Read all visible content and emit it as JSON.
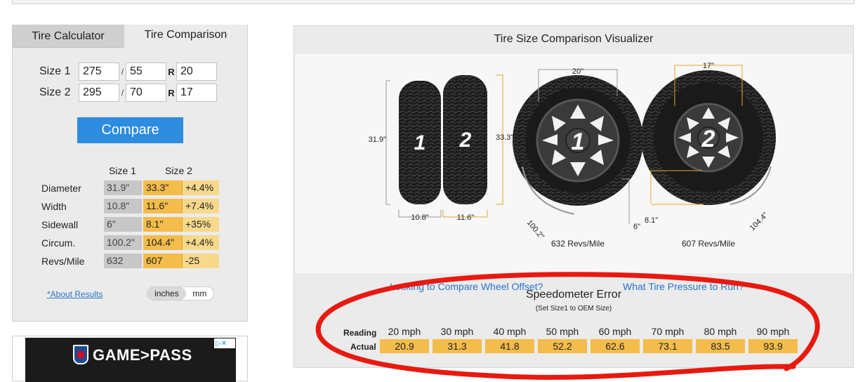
{
  "tabs": {
    "calculator": "Tire Calculator",
    "comparison": "Tire Comparison"
  },
  "inputs": {
    "size1": {
      "label": "Size 1",
      "width": "275",
      "aspect": "55",
      "rim": "20"
    },
    "size2": {
      "label": "Size 2",
      "width": "295",
      "aspect": "70",
      "rim": "17"
    },
    "slash": "/",
    "r": "R"
  },
  "compare_label": "Compare",
  "results": {
    "header_size1": "Size 1",
    "header_size2": "Size 2",
    "rows": [
      {
        "label": "Diameter",
        "s1": "31.9\"",
        "s2": "33.3\"",
        "diff": "+4.4%"
      },
      {
        "label": "Width",
        "s1": "10.8\"",
        "s2": "11.6\"",
        "diff": "+7.4%"
      },
      {
        "label": "Sidewall",
        "s1": "6\"",
        "s2": "8.1\"",
        "diff": "+35%"
      },
      {
        "label": "Circum.",
        "s1": "100.2\"",
        "s2": "104.4\"",
        "diff": "+4.4%"
      },
      {
        "label": "Revs/Mile",
        "s1": "632",
        "s2": "607",
        "diff": "-25"
      }
    ]
  },
  "about_link": "*About Results",
  "units": {
    "inches": "inches",
    "mm": "mm"
  },
  "ad": {
    "text": "GAME>PASS",
    "badge": "▷✕"
  },
  "visualizer": {
    "title": "Tire Size Comparison Visualizer",
    "tire1_number": "1",
    "tire2_number": "2",
    "dim_diameter1": "31.9\"",
    "dim_diameter2": "33.3\"",
    "dim_width1": "10.8\"",
    "dim_width2": "11.6\"",
    "rim1": "20\"",
    "rim2": "17\"",
    "sidewall1": "6\"",
    "sidewall2": "8.1\"",
    "circ1": "100.2\"",
    "circ2": "104.4\"",
    "revs1": "632 Revs/Mile",
    "revs2": "607 Revs/Mile",
    "link_offset": "Looking to Compare Wheel Offset?",
    "link_pressure": "What Tire Pressure to Run?"
  },
  "speedometer": {
    "title": "Speedometer Error",
    "subtitle": "(Set Size1 to OEM Size)",
    "reading_label": "Reading",
    "actual_label": "Actual",
    "readings": [
      "20 mph",
      "30 mph",
      "40 mph",
      "50 mph",
      "60 mph",
      "70 mph",
      "80 mph",
      "90 mph"
    ],
    "actuals": [
      "20.9",
      "31.3",
      "41.8",
      "52.2",
      "62.6",
      "73.1",
      "83.5",
      "93.9"
    ]
  },
  "colors": {
    "accent_blue": "#2d8be0",
    "highlight_orange": "#f3bc4b",
    "annotation_red": "#e8190f"
  }
}
